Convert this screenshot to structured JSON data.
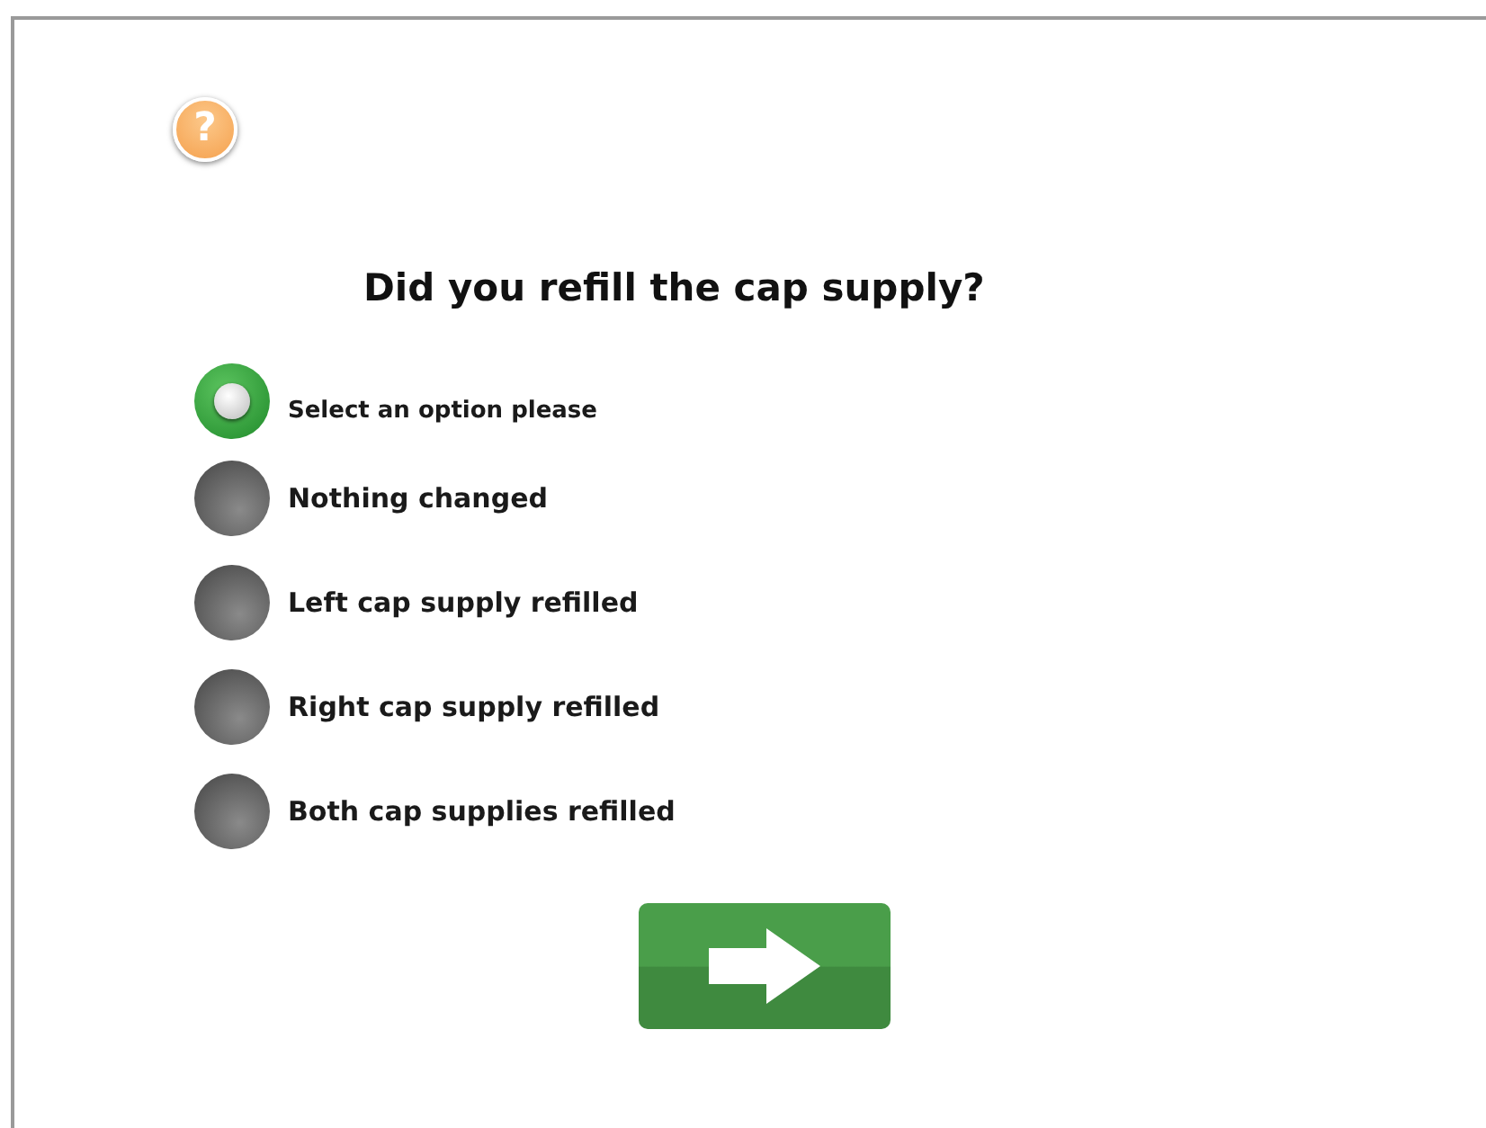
{
  "help": {
    "label": "?"
  },
  "question": "Did you refill the cap supply?",
  "options": [
    {
      "label": "Select an option please",
      "selected": true
    },
    {
      "label": "Nothing changed",
      "selected": false
    },
    {
      "label": "Left cap supply refilled",
      "selected": false
    },
    {
      "label": "Right cap supply refilled",
      "selected": false
    },
    {
      "label": "Both cap supplies refilled",
      "selected": false
    }
  ],
  "next_button": {
    "kind": "arrow"
  }
}
